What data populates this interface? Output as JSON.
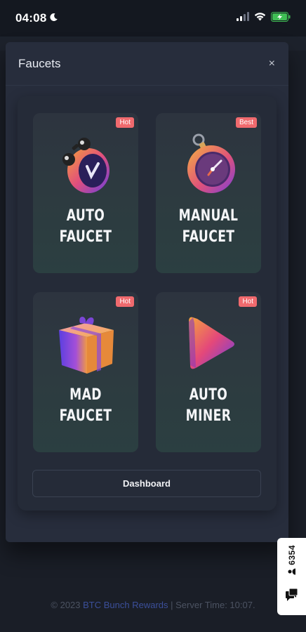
{
  "status_bar": {
    "time": "04:08",
    "moon_icon": "moon-icon",
    "signal_icon": "cellular-signal-icon",
    "wifi_icon": "wifi-icon",
    "battery_icon": "battery-charging-icon"
  },
  "modal": {
    "title": "Faucets",
    "close_label": "×"
  },
  "cards": [
    {
      "badge": "Hot",
      "line1": "AUTO",
      "line2": "FAUCET",
      "icon": "alarm-clock-icon"
    },
    {
      "badge": "Best",
      "line1": "MANUAL",
      "line2": "FAUCET",
      "icon": "stopwatch-icon"
    },
    {
      "badge": "Hot",
      "line1": "MAD",
      "line2": "FAUCET",
      "icon": "gift-box-icon"
    },
    {
      "badge": "Hot",
      "line1": "AUTO",
      "line2": "MINER",
      "icon": "play-triangle-icon"
    }
  ],
  "dashboard_label": "Dashboard",
  "footer": {
    "prefix": "© 2023 ",
    "link": "BTC Bunch Rewards",
    "suffix": " | Server Time: 10:07."
  },
  "side_widget": {
    "count": "6354",
    "user_icon": "user-icon",
    "chat_icon": "chat-bubbles-icon"
  },
  "colors": {
    "badge": "#f06a6e",
    "link": "#3b4f9a",
    "modal_bg": "#272d3c",
    "page_bg": "#1a1e27"
  }
}
